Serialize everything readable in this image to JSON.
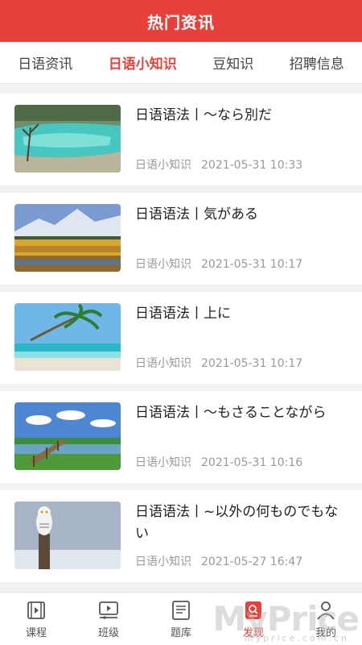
{
  "header": {
    "title": "热门资讯"
  },
  "tabs": [
    {
      "label": "日语资讯",
      "active": false
    },
    {
      "label": "日语小知识",
      "active": true
    },
    {
      "label": "豆知识",
      "active": false
    },
    {
      "label": "招聘信息",
      "active": false
    }
  ],
  "articles": [
    {
      "title": "日语语法丨～なら別だ",
      "category": "日语小知识",
      "date": "2021-05-31 10:33",
      "image": "turquoise-pools"
    },
    {
      "title": "日语语法丨気がある",
      "category": "日语小知识",
      "date": "2021-05-31 10:17",
      "image": "autumn-mountains"
    },
    {
      "title": "日语语法丨上に",
      "category": "日语小知识",
      "date": "2021-05-31 10:17",
      "image": "palm-beach"
    },
    {
      "title": "日语语法丨～もさることながら",
      "category": "日语小知识",
      "date": "2021-05-31 10:16",
      "image": "wooden-pier"
    },
    {
      "title": "日语语法丨~以外の何ものでもない",
      "category": "日语小知识",
      "date": "2021-05-27 16:47",
      "image": "snowy-owl"
    }
  ],
  "bottom_nav": [
    {
      "label": "课程",
      "icon": "course-icon",
      "active": false
    },
    {
      "label": "班级",
      "icon": "class-icon",
      "active": false
    },
    {
      "label": "题库",
      "icon": "question-bank-icon",
      "active": false
    },
    {
      "label": "发现",
      "icon": "discover-icon",
      "active": true
    },
    {
      "label": "我的",
      "icon": "profile-icon",
      "active": false
    }
  ],
  "watermark": {
    "text": "MyPrice",
    "sub": "myprice.com.cn"
  },
  "colors": {
    "brand": "#e8403a",
    "meta": "#999999",
    "background": "#f2f2f2"
  }
}
